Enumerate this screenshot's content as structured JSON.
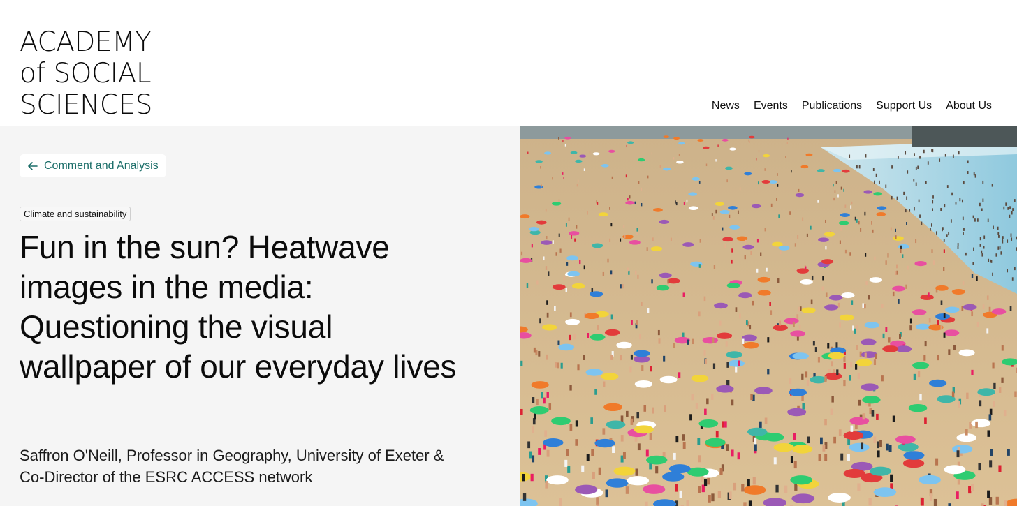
{
  "logo": {
    "line1": "ACADEMY",
    "line2": "of SOCIAL",
    "line3": "SCIENCES"
  },
  "nav": {
    "items": [
      {
        "label": "News"
      },
      {
        "label": "Events"
      },
      {
        "label": "Publications"
      },
      {
        "label": "Support Us"
      },
      {
        "label": "About Us"
      }
    ]
  },
  "article": {
    "back_label": "Comment and Analysis",
    "back_icon": "arrow-left-icon",
    "category": "Climate and sustainability",
    "title": "Fun in the sun? Heatwave images in the media: Questioning the visual wallpaper of our everyday lives",
    "byline": "Saffron O'Neill, Professor in Geography, University of Exeter & Co-Director of the ESRC ACCESS network"
  },
  "colors": {
    "accent": "#1a6d68",
    "panel_bg": "#f5f5f5",
    "sand": "#d7b889",
    "sea": "#a9d8ea"
  }
}
